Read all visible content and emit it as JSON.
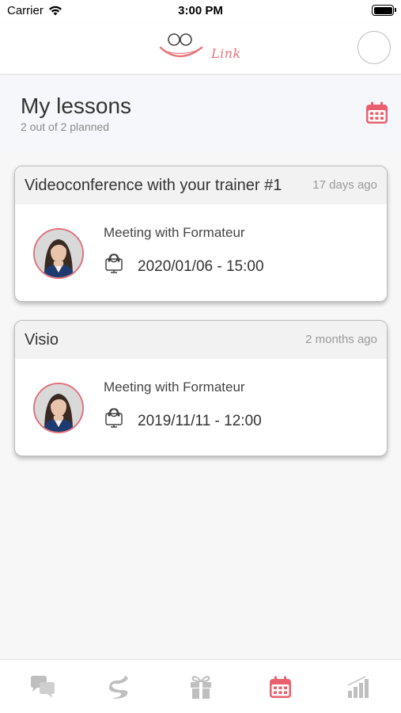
{
  "status_bar": {
    "carrier": "Carrier",
    "time": "3:00 PM"
  },
  "header": {
    "logo_text": "Link",
    "logo_icon": "smiley-eyes-logo",
    "profile_icon": "profile-circle"
  },
  "page": {
    "title": "My lessons",
    "subtitle": "2 out of 2 planned",
    "header_icon": "calendar-icon"
  },
  "lessons": [
    {
      "title": "Videoconference with your trainer #1",
      "time_ago": "17 days ago",
      "meeting_label": "Meeting with Formateur",
      "date": "2020/01/06 - 15:00",
      "icon": "visio-headset-icon"
    },
    {
      "title": "Visio",
      "time_ago": "2 months ago",
      "meeting_label": "Meeting with Formateur",
      "date": "2019/11/11 - 12:00",
      "icon": "visio-headset-icon"
    }
  ],
  "tabs": [
    {
      "name": "chat",
      "icon": "chat-bubbles-icon",
      "active": false
    },
    {
      "name": "path",
      "icon": "road-icon",
      "active": false
    },
    {
      "name": "gifts",
      "icon": "gift-icon",
      "active": false
    },
    {
      "name": "lessons",
      "icon": "calendar-icon",
      "active": true
    },
    {
      "name": "stats",
      "icon": "bar-chart-icon",
      "active": false
    }
  ],
  "colors": {
    "accent": "#e8606e",
    "tab_inactive": "#bfbfbf",
    "avatar_border": "#e1707c"
  }
}
